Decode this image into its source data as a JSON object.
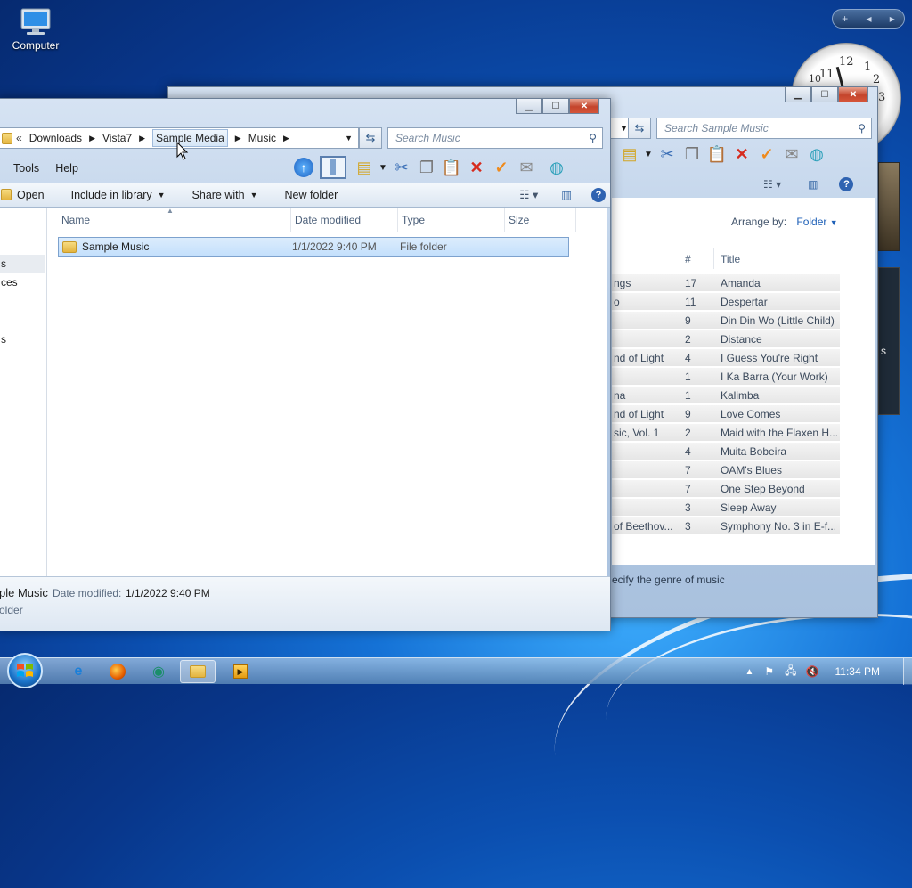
{
  "desktop": {
    "computer_icon_label": "Computer"
  },
  "clock_numbers": {
    "n10": "10",
    "n11": "11",
    "n12": "12",
    "n1": "1",
    "n2": "2",
    "n3": "3"
  },
  "back_window": {
    "search_placeholder": "Search Sample Music",
    "arrange_by_label": "Arrange by:",
    "arrange_by_value": "Folder",
    "columns": {
      "number": "#",
      "title": "Title"
    },
    "rows": [
      {
        "album": "ngs",
        "num": "17",
        "title": "Amanda"
      },
      {
        "album": "o",
        "num": "11",
        "title": "Despertar"
      },
      {
        "album": "",
        "num": "9",
        "title": "Din Din Wo (Little Child)"
      },
      {
        "album": "",
        "num": "2",
        "title": "Distance"
      },
      {
        "album": "nd of Light",
        "num": "4",
        "title": "I Guess You're Right"
      },
      {
        "album": "",
        "num": "1",
        "title": "I Ka Barra (Your Work)"
      },
      {
        "album": "na",
        "num": "1",
        "title": "Kalimba"
      },
      {
        "album": "nd of Light",
        "num": "9",
        "title": "Love Comes"
      },
      {
        "album": "sic, Vol. 1",
        "num": "2",
        "title": "Maid with the Flaxen H..."
      },
      {
        "album": "",
        "num": "4",
        "title": "Muita Bobeira"
      },
      {
        "album": "",
        "num": "7",
        "title": "OAM's Blues"
      },
      {
        "album": "",
        "num": "7",
        "title": "One Step Beyond"
      },
      {
        "album": "",
        "num": "3",
        "title": "Sleep Away"
      },
      {
        "album": "of Beethov...",
        "num": "3",
        "title": "Symphony No. 3 in E-f..."
      }
    ],
    "details_text": "ecify the genre of music",
    "right_edge_text": "s"
  },
  "front_window": {
    "breadcrumb": {
      "overflow": "«",
      "items": [
        "Downloads",
        "Vista7",
        "Sample Media",
        "Music"
      ]
    },
    "search_placeholder": "Search Music",
    "menu": {
      "tools": "Tools",
      "help": "Help"
    },
    "commands": {
      "open": "Open",
      "include": "Include in library",
      "share": "Share with",
      "new_folder": "New folder"
    },
    "columns": {
      "name": "Name",
      "date": "Date modified",
      "type": "Type",
      "size": "Size"
    },
    "file": {
      "name": "Sample Music",
      "date": "1/1/2022 9:40 PM",
      "type": "File folder"
    },
    "nav_fragments": [
      "s",
      "ces",
      "s"
    ],
    "details": {
      "name": "ple Music",
      "date_label": "Date modified:",
      "date_value": "1/1/2022 9:40 PM",
      "kind": "older"
    }
  },
  "taskbar": {
    "time": "11:34 PM"
  }
}
